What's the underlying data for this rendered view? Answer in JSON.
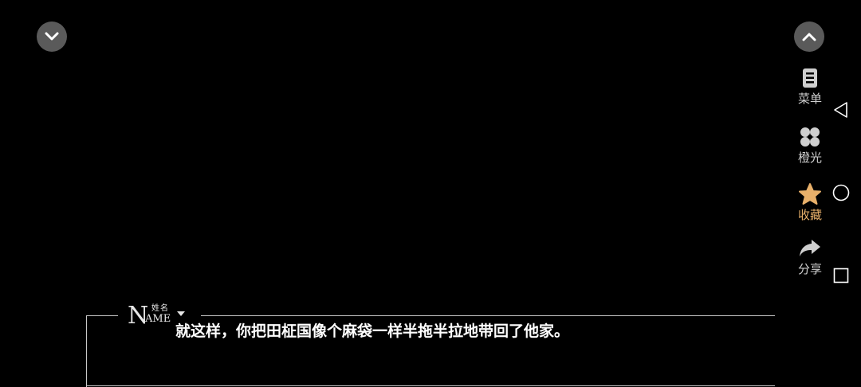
{
  "top_controls": {
    "left_icon": "chevron-down-icon",
    "right_icon": "chevron-up-icon"
  },
  "side_menu": {
    "items": [
      {
        "label": "菜单",
        "icon": "menu-icon"
      },
      {
        "label": "橙光",
        "icon": "orange-light-icon"
      },
      {
        "label": "收藏",
        "icon": "star-icon",
        "color": "#e8b06a"
      },
      {
        "label": "分享",
        "icon": "share-icon"
      }
    ]
  },
  "nav_bar": {
    "icons": [
      "back-triangle-icon",
      "home-circle-icon",
      "recent-square-icon"
    ]
  },
  "dialog": {
    "name_big": "N",
    "name_small_top": "姓名",
    "name_small_bottom": "AME",
    "text": "就这样，你把田柾国像个麻袋一样半拖半拉地带回了他家。"
  }
}
